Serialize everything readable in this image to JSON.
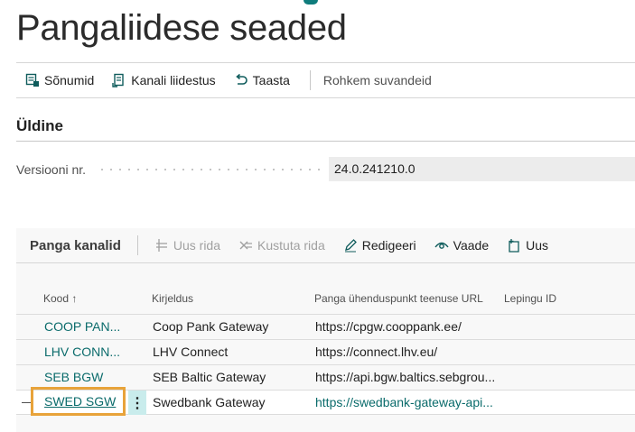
{
  "page": {
    "title": "Pangaliidese seaded"
  },
  "actions": {
    "messages": "Sõnumid",
    "channel_connection": "Kanali liidestus",
    "restore": "Taasta",
    "more_options": "Rohkem suvandeid"
  },
  "general": {
    "section_title": "Üldine",
    "version_label": "Versiooni nr.",
    "version_value": "24.0.241210.0"
  },
  "bank_channels": {
    "title": "Panga kanalid",
    "actions": {
      "new_line": "Uus rida",
      "delete_line": "Kustuta rida",
      "edit": "Redigeeri",
      "view": "Vaade",
      "new": "Uus"
    },
    "columns": {
      "code": "Kood ↑",
      "description": "Kirjeldus",
      "url": "Panga ühenduspunkt teenuse URL",
      "contract_id": "Lepingu ID"
    },
    "rows": [
      {
        "code": "COOP PAN...",
        "description": "Coop Pank Gateway",
        "url": "https://cpgw.cooppank.ee/",
        "contract_id": ""
      },
      {
        "code": "LHV CONN...",
        "description": "LHV Connect",
        "url": "https://connect.lhv.eu/",
        "contract_id": ""
      },
      {
        "code": "SEB BGW",
        "description": "SEB Baltic Gateway",
        "url": "https://api.bgw.baltics.sebgrou...",
        "contract_id": ""
      },
      {
        "code": "SWED SGW",
        "description": "Swedbank Gateway",
        "url": "https://swedbank-gateway-api...",
        "contract_id": ""
      }
    ],
    "selected_row_menu": "⋮"
  },
  "colors": {
    "accent": "#0a6b6b",
    "focus": "#e8a33a",
    "row_menu_bg": "#c9ecec"
  },
  "icons": [
    "messages-icon",
    "channel-connection-icon",
    "restore-icon",
    "new-line-icon",
    "delete-line-icon",
    "edit-icon",
    "view-icon",
    "new-icon"
  ]
}
